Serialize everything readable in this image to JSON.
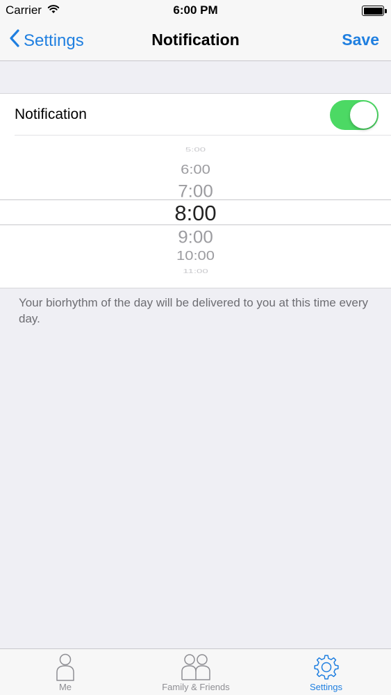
{
  "status_bar": {
    "carrier": "Carrier",
    "time": "6:00 PM",
    "wifi_icon": "wifi-icon",
    "battery_icon": "battery-icon"
  },
  "nav": {
    "back_label": "Settings",
    "title": "Notification",
    "save_label": "Save",
    "accent_color": "#1f7fe0"
  },
  "notification_row": {
    "label": "Notification",
    "toggle_on": true,
    "toggle_color": "#4cd964"
  },
  "time_picker": {
    "items": [
      "5:00",
      "6:00",
      "7:00",
      "8:00",
      "9:00",
      "10:00",
      "11:00"
    ],
    "selected": "8:00"
  },
  "footer_note": "Your biorhythm of the day will be delivered to you at this time every day.",
  "tab_bar": {
    "tabs": [
      {
        "label": "Me",
        "icon": "person-icon",
        "active": false
      },
      {
        "label": "Family & Friends",
        "icon": "people-icon",
        "active": false
      },
      {
        "label": "Settings",
        "icon": "gear-icon",
        "active": true
      }
    ]
  }
}
